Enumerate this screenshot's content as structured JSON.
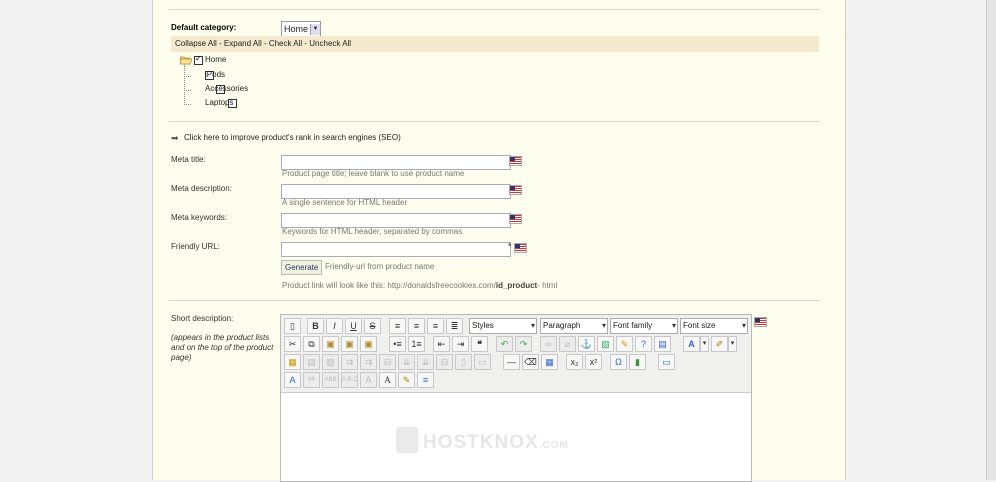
{
  "category": {
    "label": "Default category:",
    "selected": "Home",
    "tree_actions": "Collapse All - Expand All - Check All - Uncheck All",
    "tree": [
      {
        "label": "Home",
        "checked": true
      },
      {
        "label": "iPods",
        "checked": false
      },
      {
        "label": "Accessories",
        "checked": false
      },
      {
        "label": "Laptops",
        "checked": false
      }
    ]
  },
  "seo": {
    "toggle": "Click here to improve product's rank in search engines (SEO)",
    "meta_title": {
      "label": "Meta title:",
      "value": "",
      "hint": "Product page title; leave blank to use product name"
    },
    "meta_description": {
      "label": "Meta description:",
      "value": "",
      "hint": "A single sentence for HTML header"
    },
    "meta_keywords": {
      "label": "Meta keywords:",
      "value": "",
      "hint": "Keywords for HTML header, separated by commas"
    },
    "friendly_url": {
      "label": "Friendly URL:",
      "value": "",
      "required_mark": "*"
    },
    "generate_button": "Generate",
    "generate_hint": "Friendly-url from product name",
    "link_prefix": "Product link will look like this: http://donaldsfreecookies.com/",
    "link_bold": "id_product",
    "link_suffix": "- html"
  },
  "short_description": {
    "label": "Short description:",
    "note": "(appears in the product lists and on the top of the product page)",
    "toolbar": {
      "styles": "Styles",
      "format": "Paragraph",
      "font_family": "Font family",
      "font_size": "Font size"
    },
    "watermark": "HOSTKNOX",
    "watermark_suffix": ".COM"
  },
  "colors": {
    "page_bg": "#fefeee",
    "tree_bar": "#f4e9cd",
    "hint_text": "#777777"
  }
}
